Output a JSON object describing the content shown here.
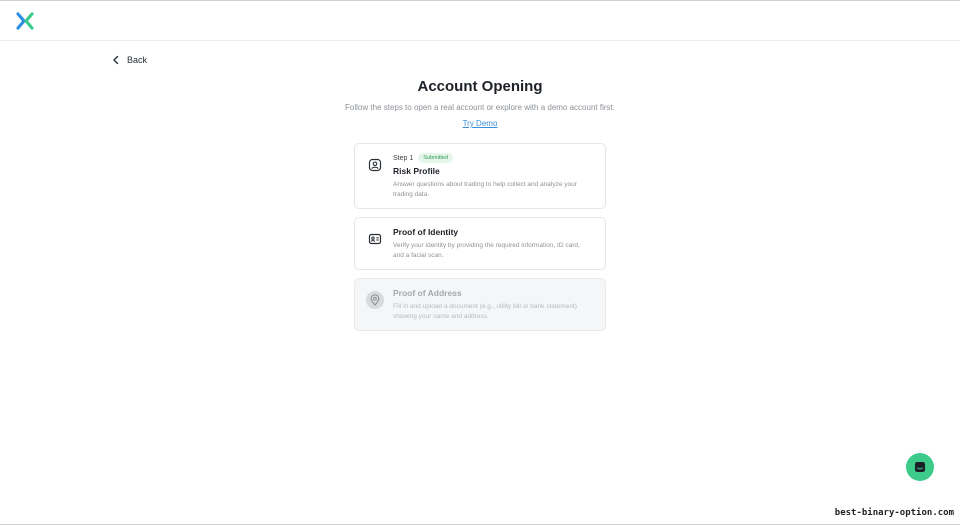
{
  "nav": {
    "back_label": "Back"
  },
  "page": {
    "title": "Account Opening",
    "subtitle": "Follow the steps to open a real account or explore with a demo account first.",
    "try_demo_label": "Try Demo"
  },
  "cards": [
    {
      "step_label": "Step 1",
      "status_badge": "Submitted",
      "title": "Risk Profile",
      "description_line1": "Answer questions about trading to help collect and analyze your",
      "description_line2": "trading data.",
      "icon": "user-badge-icon"
    },
    {
      "title": "Proof of Identity",
      "description_line1": "Verify your identity by providing the required information, ID card,",
      "description_line2": "and a facial scan.",
      "icon": "id-card-icon"
    },
    {
      "title": "Proof of Address",
      "description_line1": "Fill in and upload a document (e.g., utility bill or bank statement)",
      "description_line2": "showing your name and address.",
      "icon": "location-pin-icon"
    }
  ],
  "watermark": "best-binary-option.com",
  "colors": {
    "accent_link": "#3a8fd8",
    "chat_button": "#3ccb8a",
    "badge_bg": "#e6f6ea",
    "badge_text": "#2f9b55"
  }
}
